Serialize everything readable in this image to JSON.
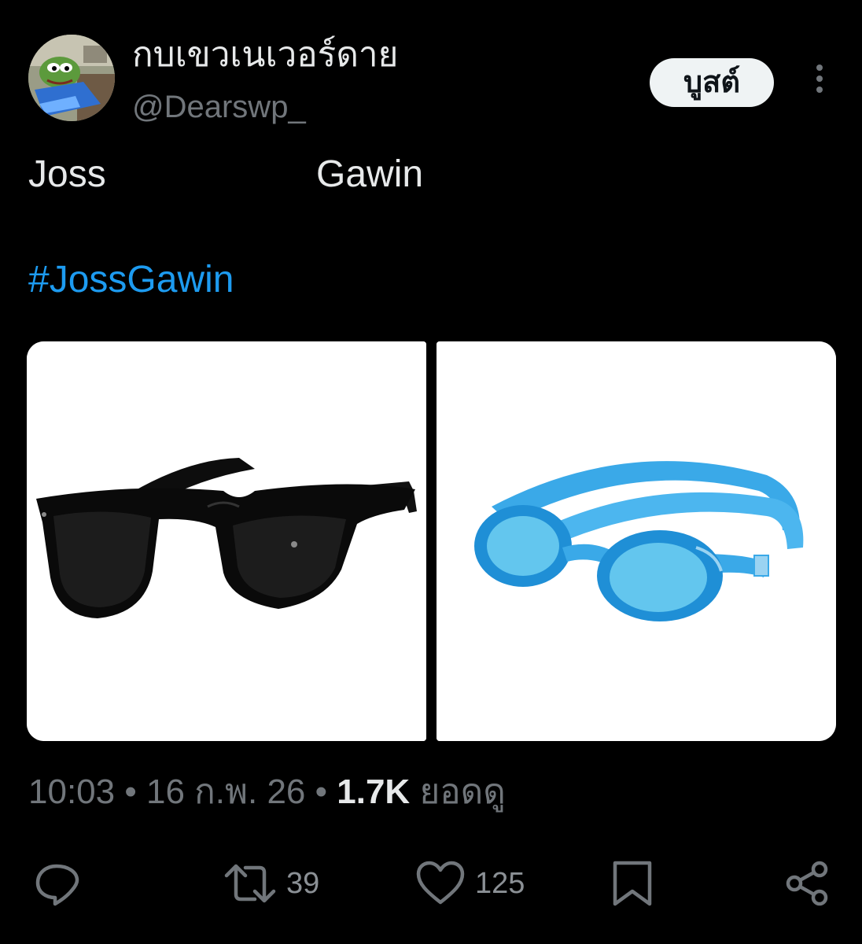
{
  "author": {
    "display_name": "กบเขวเนเวอร์ดาย",
    "handle": "@Dearswp_"
  },
  "header": {
    "boost_label": "บูสต์",
    "more_icon": "more-vertical-icon"
  },
  "tweet": {
    "text_left": "Joss",
    "text_right": "Gawin",
    "hashtag": "#JossGawin"
  },
  "media": [
    {
      "icon": "sunglasses-image"
    },
    {
      "icon": "swim-goggles-image"
    }
  ],
  "meta": {
    "time": "10:03",
    "separator": " • ",
    "date": "16 ก.พ. 26",
    "views_count": "1.7K",
    "views_label": " ยอดดู"
  },
  "actions": {
    "reply_icon": "reply-icon",
    "repost_icon": "repost-icon",
    "repost_count": "39",
    "like_icon": "heart-icon",
    "like_count": "125",
    "bookmark_icon": "bookmark-icon",
    "share_icon": "share-icon"
  },
  "colors": {
    "background": "#000000",
    "text_primary": "#e7e9ea",
    "text_secondary": "#71767b",
    "link": "#1d9bf0",
    "button_bg": "#eff3f4"
  }
}
